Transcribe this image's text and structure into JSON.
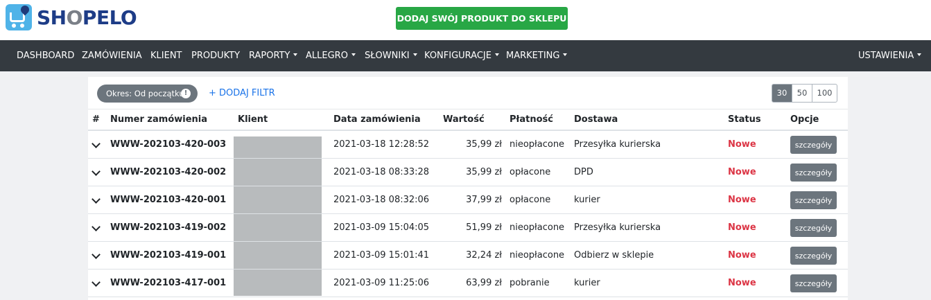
{
  "header": {
    "logo_text_pre": "SH",
    "logo_text_o": "O",
    "logo_text_post": "PELO",
    "cta_label": "DODAJ SWÓJ PRODUKT DO SKLEPU"
  },
  "nav": {
    "items": [
      {
        "label": "DASHBOARD",
        "dropdown": false
      },
      {
        "label": "ZAMÓWIENIA",
        "dropdown": false
      },
      {
        "label": "KLIENT",
        "dropdown": false
      },
      {
        "label": "PRODUKTY",
        "dropdown": false
      },
      {
        "label": "RAPORTY",
        "dropdown": true
      },
      {
        "label": "ALLEGRO",
        "dropdown": true
      },
      {
        "label": "SŁOWNIKI",
        "dropdown": true
      },
      {
        "label": "KONFIGURACJE",
        "dropdown": true
      },
      {
        "label": "MARKETING",
        "dropdown": true
      }
    ],
    "settings_label": "USTAWIENIA"
  },
  "filters": {
    "period_label": "Okres: Od początku",
    "alert_glyph": "!",
    "add_filter_label": "+ DODAJ FILTR"
  },
  "pagination": {
    "options": [
      "30",
      "50",
      "100"
    ],
    "active": "30"
  },
  "table": {
    "columns": [
      "#",
      "Numer zamówienia",
      "Klient",
      "Data zamówienia",
      "Wartość",
      "Płatność",
      "Dostawa",
      "Status",
      "Opcje"
    ],
    "details_label": "szczegóły",
    "rows": [
      {
        "order": "WWW-202103-420-003",
        "date": "2021-03-18 12:28:52",
        "value": "35,99 zł",
        "payment": "nieopłacone",
        "delivery": "Przesyłka kurierska",
        "status": "Nowe"
      },
      {
        "order": "WWW-202103-420-002",
        "date": "2021-03-18 08:33:28",
        "value": "35,99 zł",
        "payment": "opłacone",
        "delivery": "DPD",
        "status": "Nowe"
      },
      {
        "order": "WWW-202103-420-001",
        "date": "2021-03-18 08:32:06",
        "value": "37,99 zł",
        "payment": "opłacone",
        "delivery": "kurier",
        "status": "Nowe"
      },
      {
        "order": "WWW-202103-419-002",
        "date": "2021-03-09 15:04:05",
        "value": "51,99 zł",
        "payment": "nieopłacone",
        "delivery": "Przesyłka kurierska",
        "status": "Nowe"
      },
      {
        "order": "WWW-202103-419-001",
        "date": "2021-03-09 15:01:41",
        "value": "32,24 zł",
        "payment": "nieopłacone",
        "delivery": "Odbierz w sklepie",
        "status": "Nowe"
      },
      {
        "order": "WWW-202103-417-001",
        "date": "2021-03-09 11:25:06",
        "value": "63,99 zł",
        "payment": "pobranie",
        "delivery": "kurier",
        "status": "Nowe"
      }
    ]
  },
  "colors": {
    "cta": "#28a745",
    "nav_bg": "#343a40",
    "status_new": "#dc3545",
    "link": "#1a73e8",
    "secondary": "#6c757d"
  }
}
